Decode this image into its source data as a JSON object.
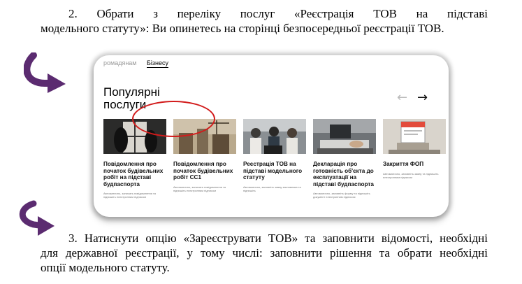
{
  "paragraph_2": {
    "line1": "2. Обрати з переліку послуг «Реєстрація ТОВ на підставі",
    "line2": "модельного статуту»: Ви опинетесь на сторінці безпосередньої реєстрації ТОВ."
  },
  "paragraph_3": {
    "line1": "3. Натиснути опцію «Зареєструвати ТОВ» та заповнити відомості, необхідні",
    "line2": "для державної реєстрації, у тому числі: заповнити рішення та обрати необхідні",
    "line3": "опції модельного статуту."
  },
  "screenshot": {
    "tabs": [
      {
        "label": "ромадянам"
      },
      {
        "label": "Бізнесу"
      }
    ],
    "heading_line1": "Популярні",
    "heading_line2": "послуги",
    "prev_arrow": "←",
    "next_arrow": "→",
    "cards": [
      {
        "title": "Повідомлення про початок будівельних робіт на підставі будпаспорта",
        "desc": "Автоматично, записать повідомлення та підпишіть електронним підписом"
      },
      {
        "title": "Повідомлення про початок будівельних робіт СС1",
        "desc": "Автоматично, записать повідомлення та підпишіть електронним підписом"
      },
      {
        "title": "Реєстрація ТОВ на підставі модельного статуту",
        "desc": "Автоматично, заповніть заяву засновника та підпишіть"
      },
      {
        "title": "Декларація про готовність об'єкта до експлуатації на підставі будпаспорта",
        "desc": "Автоматично, заповніть форму та підпишіть документ електронним підписом"
      },
      {
        "title": "Закриття ФОП",
        "desc": "Автоматично, заповніть заяву та підпишіть електронним підписом"
      }
    ]
  },
  "colors": {
    "arrow": "#5b2b70",
    "highlight_oval": "#d21b1b"
  }
}
